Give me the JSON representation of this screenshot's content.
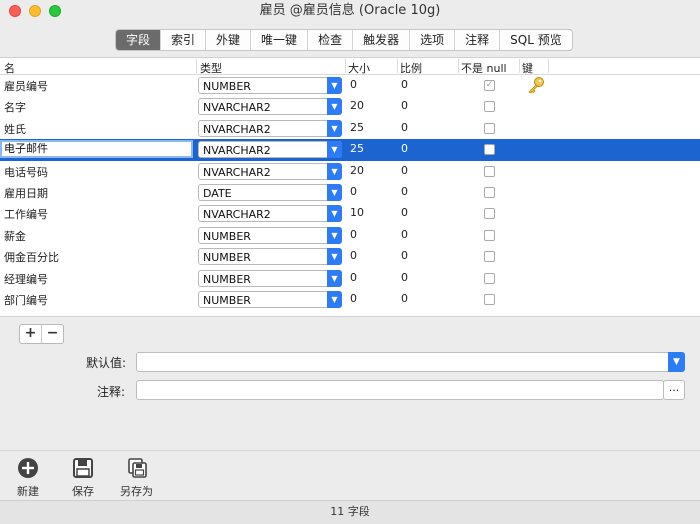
{
  "window": {
    "title": "雇员 @雇员信息 (Oracle 10g)"
  },
  "tabs": [
    {
      "label": "字段",
      "active": true
    },
    {
      "label": "索引"
    },
    {
      "label": "外键"
    },
    {
      "label": "唯一键"
    },
    {
      "label": "检查"
    },
    {
      "label": "触发器"
    },
    {
      "label": "选项"
    },
    {
      "label": "注释"
    },
    {
      "label": "SQL 预览"
    }
  ],
  "grid": {
    "headers": {
      "name": "名",
      "type": "类型",
      "size": "大小",
      "scale": "比例",
      "notnull": "不是 null",
      "key": "键"
    },
    "rows": [
      {
        "name": "雇员编号",
        "type": "NUMBER",
        "size": "0",
        "scale": "0",
        "notnull": true,
        "key": true
      },
      {
        "name": "名字",
        "type": "NVARCHAR2",
        "size": "20",
        "scale": "0",
        "notnull": false
      },
      {
        "name": "姓氏",
        "type": "NVARCHAR2",
        "size": "25",
        "scale": "0",
        "notnull": false
      },
      {
        "name": "电子邮件",
        "type": "NVARCHAR2",
        "size": "25",
        "scale": "0",
        "notnull": false,
        "selected": true
      },
      {
        "name": "电话号码",
        "type": "NVARCHAR2",
        "size": "20",
        "scale": "0",
        "notnull": false
      },
      {
        "name": "雇用日期",
        "type": "DATE",
        "size": "0",
        "scale": "0",
        "notnull": false
      },
      {
        "name": "工作编号",
        "type": "NVARCHAR2",
        "size": "10",
        "scale": "0",
        "notnull": false
      },
      {
        "name": "薪金",
        "type": "NUMBER",
        "size": "0",
        "scale": "0",
        "notnull": false
      },
      {
        "name": "佣金百分比",
        "type": "NUMBER",
        "size": "0",
        "scale": "0",
        "notnull": false
      },
      {
        "name": "经理编号",
        "type": "NUMBER",
        "size": "0",
        "scale": "0",
        "notnull": false
      },
      {
        "name": "部门编号",
        "type": "NUMBER",
        "size": "0",
        "scale": "0",
        "notnull": false
      }
    ]
  },
  "buttons": {
    "add": "+",
    "remove": "−"
  },
  "form": {
    "default_label": "默认值:",
    "default_value": "",
    "comment_label": "注释:",
    "comment_value": "",
    "dots": "..."
  },
  "toolbar": {
    "new": "新建",
    "save": "保存",
    "save_as": "另存为"
  },
  "status": "11 字段",
  "colors": {
    "accent": "#2d7cf6",
    "selection": "#1c65d0",
    "active_tab": "#6b6b6b"
  },
  "icons": [
    "close-light",
    "minimize-light",
    "zoom-light",
    "chevron-down-icon",
    "key-icon",
    "plus-circle-icon",
    "save-icon",
    "save-as-icon"
  ]
}
